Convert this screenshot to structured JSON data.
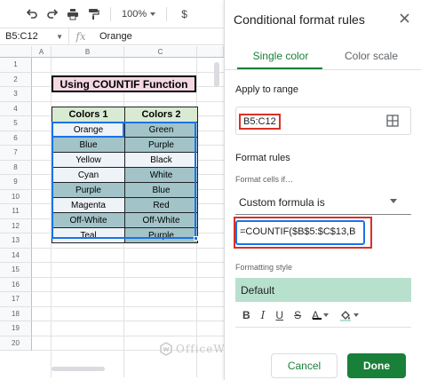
{
  "toolbar": {
    "zoom": "100%"
  },
  "formula_bar": {
    "name_box": "B5:C12",
    "fx": "fx",
    "value": "Orange"
  },
  "sheet": {
    "columns": [
      "A",
      "B",
      "C"
    ],
    "rows": [
      "1",
      "2",
      "3",
      "4",
      "5",
      "6",
      "7",
      "8",
      "9",
      "10",
      "11",
      "12",
      "13",
      "14",
      "15",
      "16",
      "17",
      "18",
      "19",
      "20"
    ],
    "title": "Using COUNTIF Function",
    "table": {
      "headers": [
        "Colors 1",
        "Colors 2"
      ],
      "rows": [
        [
          "Orange",
          "Green"
        ],
        [
          "Blue",
          "Purple"
        ],
        [
          "Yellow",
          "Black"
        ],
        [
          "Cyan",
          "White"
        ],
        [
          "Purple",
          "Blue"
        ],
        [
          "Magenta",
          "Red"
        ],
        [
          "Off-White",
          "Off-White"
        ],
        [
          "Teal",
          "Purple"
        ]
      ]
    },
    "colors": {
      "header_fill": "#d9ead3",
      "highlight_fill": "#a2c4c9",
      "plain_fill": "#eef3f8"
    }
  },
  "watermark": "OfficeWheel",
  "panel": {
    "title": "Conditional format rules",
    "tabs": [
      "Single color",
      "Color scale"
    ],
    "apply_to_range_label": "Apply to range",
    "range_value": "B5:C12",
    "format_rules_label": "Format rules",
    "format_cells_if_label": "Format cells if…",
    "condition": "Custom formula is",
    "formula": "=COUNTIF($B$5:$C$13,B",
    "formatting_style_label": "Formatting style",
    "style_preview": "Default",
    "style_tools": [
      "B",
      "I",
      "U",
      "S",
      "A"
    ],
    "cancel_label": "Cancel",
    "done_label": "Done",
    "colors": {
      "accent": "#188038",
      "preview_fill": "#b7e1cd",
      "focus_blue": "#1a73e8",
      "callout_red": "#d93025"
    }
  }
}
